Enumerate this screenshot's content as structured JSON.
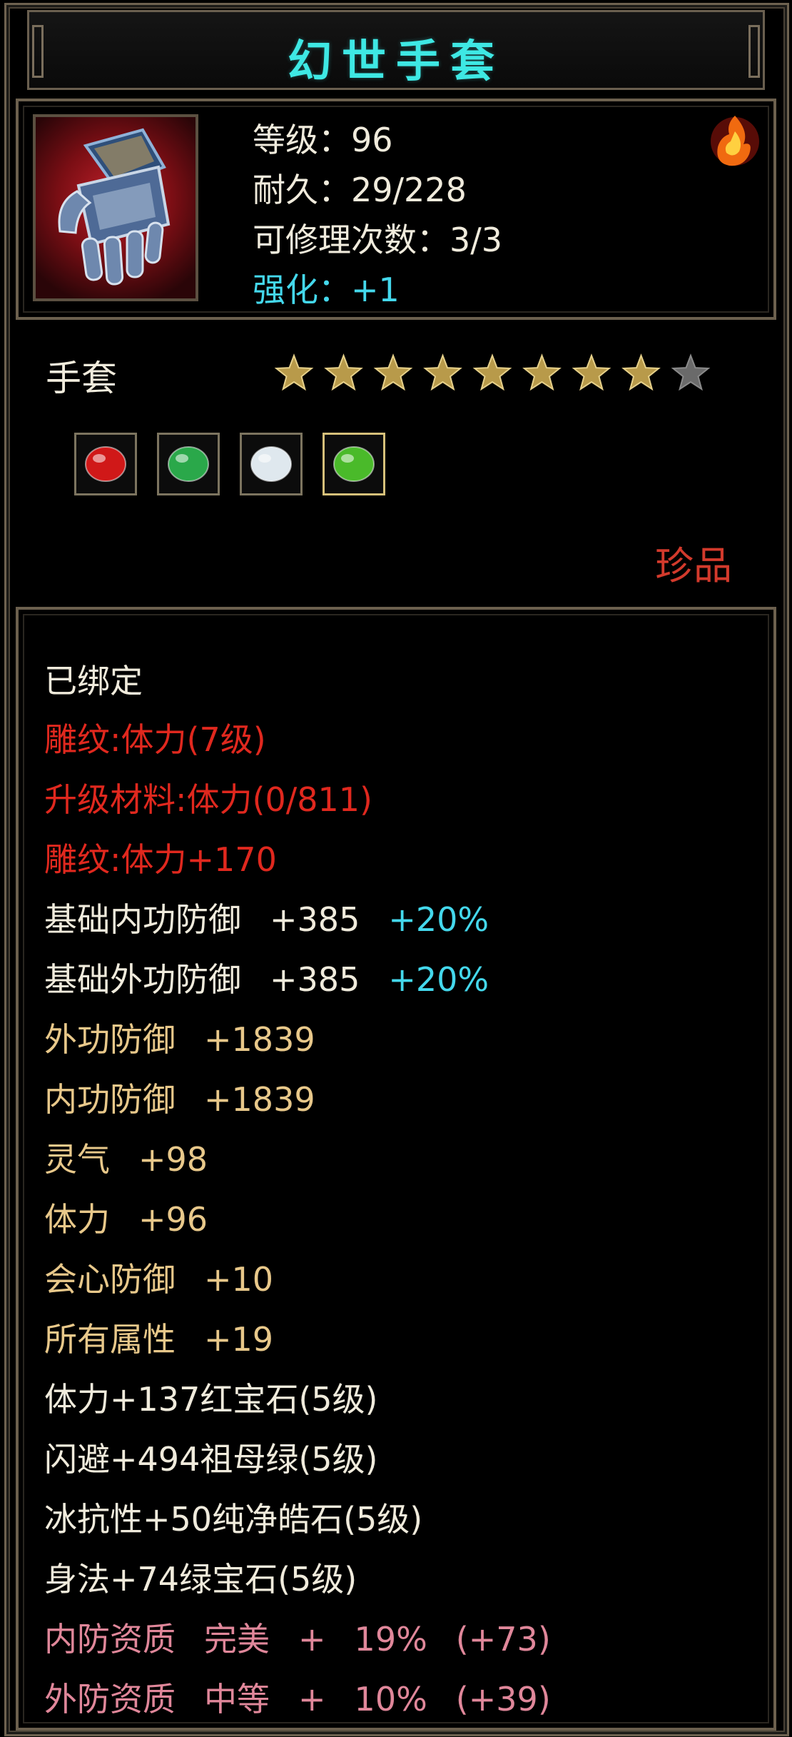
{
  "item": {
    "title": "幻世手套",
    "icon_name": "gauntlet-icon",
    "corner_icon_name": "fire-icon",
    "level": "等级：96",
    "durability": "耐久：29/228",
    "repairs": "可修理次数：3/3",
    "enhance": "强化：+1",
    "type": "手套",
    "stars_filled": 8,
    "stars_total": 9,
    "gems": [
      {
        "name": "ruby-gem-icon",
        "color": "#d01818"
      },
      {
        "name": "emerald-gem-icon",
        "color": "#2aa84a"
      },
      {
        "name": "diamond-gem-icon",
        "color": "#dfe8ee"
      },
      {
        "name": "green-gem-icon",
        "color": "#4aba2a"
      }
    ],
    "rarity": "珍品"
  },
  "attributes": {
    "bound": "已绑定",
    "engrave_level": "雕纹:体力(7级)",
    "upgrade_material": "升级材料:体力(0/811)",
    "engrave_bonus": "雕纹:体力+170",
    "inner_def_base": {
      "label": "基础内功防御",
      "value": "+385",
      "pct": "+20%"
    },
    "outer_def_base": {
      "label": "基础外功防御",
      "value": "+385",
      "pct": "+20%"
    },
    "outer_def": {
      "label": "外功防御",
      "value": "+1839"
    },
    "inner_def": {
      "label": "内功防御",
      "value": "+1839"
    },
    "spirit": {
      "label": "灵气",
      "value": "+98"
    },
    "stamina": {
      "label": "体力",
      "value": "+96"
    },
    "crit_def": {
      "label": "会心防御",
      "value": "+10"
    },
    "all_attr": {
      "label": "所有属性",
      "value": "+19"
    },
    "gem1": "体力+137红宝石(5级)",
    "gem2": "闪避+494祖母绿(5级)",
    "gem3": "冰抗性+50纯净皓石(5级)",
    "gem4": "身法+74绿宝石(5级)",
    "quality1": {
      "label": "内防资质",
      "grade": "完美",
      "sep": "+",
      "pct": "19%",
      "extra": "(+73)"
    },
    "quality2": {
      "label": "外防资质",
      "grade": "中等",
      "sep": "+",
      "pct": "10%",
      "extra": "(+39)"
    }
  },
  "colors": {
    "title": "#3ee8e4",
    "white": "#f0ebdc",
    "red": "#e0281e",
    "gold": "#e8c88a",
    "cyan": "#44d8ec",
    "pink": "#e0879a",
    "rarity": "#d33a2c",
    "star_on": "#b89a4a",
    "star_off": "#6a6a6a"
  }
}
